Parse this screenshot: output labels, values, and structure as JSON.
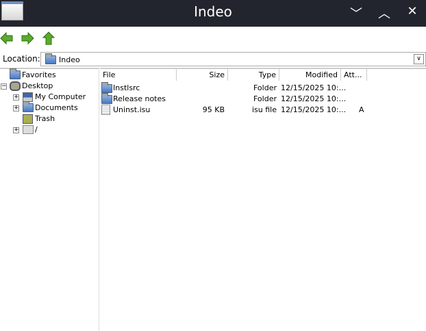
{
  "window": {
    "title": "Indeo",
    "buttons": [
      "minimize",
      "maximize",
      "close"
    ]
  },
  "toolbar": {
    "back": "back-icon",
    "forward": "forward-icon",
    "up": "up-icon"
  },
  "location": {
    "label": "Location:",
    "value": "Indeo"
  },
  "tree": [
    {
      "label": "Favorites"
    },
    {
      "label": "Desktop",
      "expander": "−"
    },
    {
      "label": "My Computer",
      "expander": "+"
    },
    {
      "label": "Documents",
      "expander": "+"
    },
    {
      "label": "Trash"
    },
    {
      "label": "/",
      "expander": "+"
    }
  ],
  "columns": [
    "File",
    "Size",
    "Type",
    "Modified",
    "Att..."
  ],
  "files": [
    {
      "name": "Instlsrc",
      "size": "",
      "type": "Folder",
      "modified": "12/15/2025 10:...",
      "attr": ""
    },
    {
      "name": "Release notes",
      "size": "",
      "type": "Folder",
      "modified": "12/15/2025 10:...",
      "attr": ""
    },
    {
      "name": "Uninst.isu",
      "size": "95 KB",
      "type": "isu file",
      "modified": "12/15/2025 10:...",
      "attr": "A"
    }
  ]
}
